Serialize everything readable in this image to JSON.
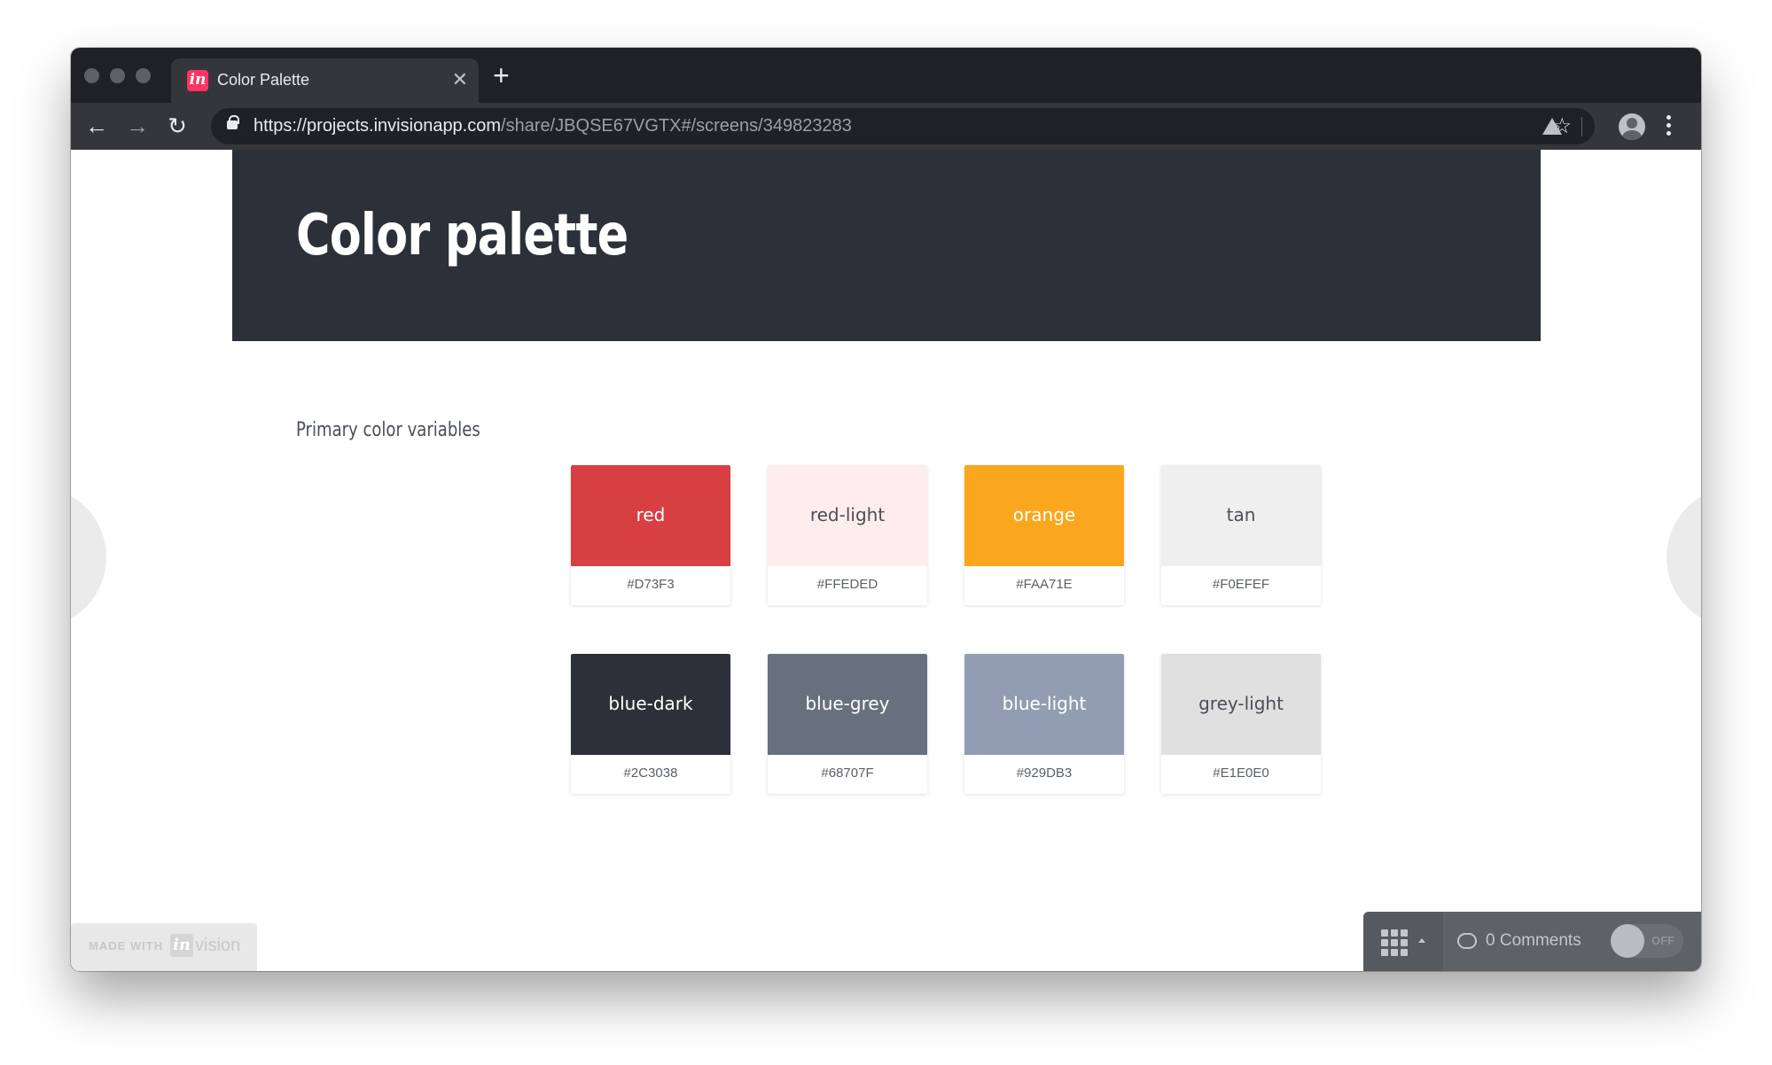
{
  "browser": {
    "tab_title": "Color Palette",
    "tab_favicon_text": "in",
    "url_host": "https://projects.invisionapp.com",
    "url_path": "/share/JBQSE67VGTX#/screens/349823283"
  },
  "page": {
    "title": "Color palette",
    "section_label": "Primary color variables"
  },
  "swatches": [
    {
      "name": "red",
      "hex": "#D73F3",
      "color": "#D73F43",
      "text_color": "#ffffff"
    },
    {
      "name": "red-light",
      "hex": "#FFEDED",
      "color": "#FFEDED",
      "text_color": "#4a4f57"
    },
    {
      "name": "orange",
      "hex": "#FAA71E",
      "color": "#FAA71E",
      "text_color": "#ffffff"
    },
    {
      "name": "tan",
      "hex": "#F0EFEF",
      "color": "#F0EFEF",
      "text_color": "#4a4f57"
    },
    {
      "name": "blue-dark",
      "hex": "#2C3038",
      "color": "#2C3038",
      "text_color": "#ffffff"
    },
    {
      "name": "blue-grey",
      "hex": "#68707F",
      "color": "#68707F",
      "text_color": "#ffffff"
    },
    {
      "name": "blue-light",
      "hex": "#929DB3",
      "color": "#929DB3",
      "text_color": "#ffffff"
    },
    {
      "name": "grey-light",
      "hex": "#E1E0E0",
      "color": "#E1E0E0",
      "text_color": "#4a4f57"
    }
  ],
  "footer": {
    "made_with": "MADE WITH",
    "logo_text": "in",
    "brand": "vision",
    "comments": "0 Comments",
    "toggle_label": "OFF"
  },
  "colors": {
    "header_band": "#2C3038",
    "chrome_dark": "#202124",
    "chrome_toolbar": "#35363A",
    "invision_pink": "#FF3366"
  }
}
